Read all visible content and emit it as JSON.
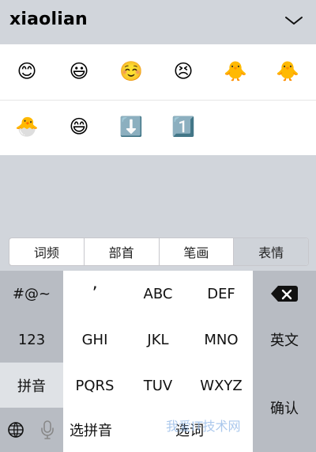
{
  "ime": {
    "composing_text": "xiaolian",
    "candidates": {
      "row1": [
        "😊",
        "😃",
        "☺️",
        "😣",
        "🐥",
        "🐥"
      ],
      "row2": [
        "🐣",
        "😄",
        "⬇️",
        "1️⃣"
      ]
    },
    "tabs": [
      "词频",
      "部首",
      "笔画",
      "表情"
    ],
    "keys": {
      "row1": {
        "left": "#@~",
        "k1": "’",
        "k2": "ABC",
        "k3": "DEF"
      },
      "row2": {
        "left": "123",
        "k1": "GHI",
        "k2": "JKL",
        "k3": "MNO",
        "right": "英文"
      },
      "row3": {
        "left": "拼音",
        "k1": "PQRS",
        "k2": "TUV",
        "k3": "WXYZ",
        "right": "确认"
      },
      "row4": {
        "left": "选拼音",
        "mid": "选词"
      }
    },
    "watermark": "我爱IT技术网"
  }
}
